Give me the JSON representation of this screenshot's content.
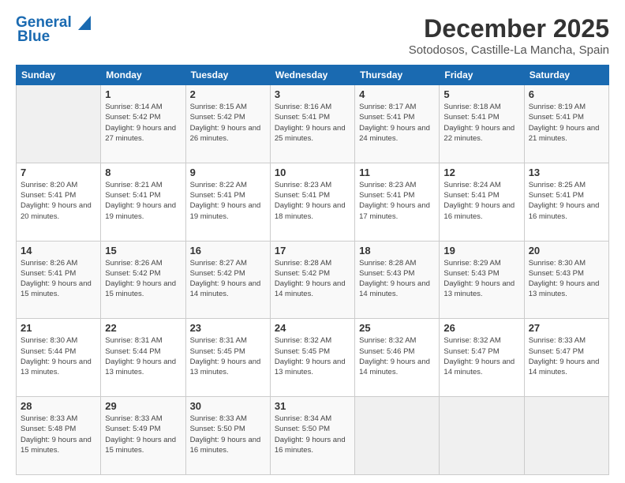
{
  "logo": {
    "text1": "General",
    "text2": "Blue"
  },
  "header": {
    "title": "December 2025",
    "subtitle": "Sotodosos, Castille-La Mancha, Spain"
  },
  "weekdays": [
    "Sunday",
    "Monday",
    "Tuesday",
    "Wednesday",
    "Thursday",
    "Friday",
    "Saturday"
  ],
  "weeks": [
    [
      {
        "day": "",
        "sunrise": "",
        "sunset": "",
        "daylight": ""
      },
      {
        "day": "1",
        "sunrise": "Sunrise: 8:14 AM",
        "sunset": "Sunset: 5:42 PM",
        "daylight": "Daylight: 9 hours and 27 minutes."
      },
      {
        "day": "2",
        "sunrise": "Sunrise: 8:15 AM",
        "sunset": "Sunset: 5:42 PM",
        "daylight": "Daylight: 9 hours and 26 minutes."
      },
      {
        "day": "3",
        "sunrise": "Sunrise: 8:16 AM",
        "sunset": "Sunset: 5:41 PM",
        "daylight": "Daylight: 9 hours and 25 minutes."
      },
      {
        "day": "4",
        "sunrise": "Sunrise: 8:17 AM",
        "sunset": "Sunset: 5:41 PM",
        "daylight": "Daylight: 9 hours and 24 minutes."
      },
      {
        "day": "5",
        "sunrise": "Sunrise: 8:18 AM",
        "sunset": "Sunset: 5:41 PM",
        "daylight": "Daylight: 9 hours and 22 minutes."
      },
      {
        "day": "6",
        "sunrise": "Sunrise: 8:19 AM",
        "sunset": "Sunset: 5:41 PM",
        "daylight": "Daylight: 9 hours and 21 minutes."
      }
    ],
    [
      {
        "day": "7",
        "sunrise": "Sunrise: 8:20 AM",
        "sunset": "Sunset: 5:41 PM",
        "daylight": "Daylight: 9 hours and 20 minutes."
      },
      {
        "day": "8",
        "sunrise": "Sunrise: 8:21 AM",
        "sunset": "Sunset: 5:41 PM",
        "daylight": "Daylight: 9 hours and 19 minutes."
      },
      {
        "day": "9",
        "sunrise": "Sunrise: 8:22 AM",
        "sunset": "Sunset: 5:41 PM",
        "daylight": "Daylight: 9 hours and 19 minutes."
      },
      {
        "day": "10",
        "sunrise": "Sunrise: 8:23 AM",
        "sunset": "Sunset: 5:41 PM",
        "daylight": "Daylight: 9 hours and 18 minutes."
      },
      {
        "day": "11",
        "sunrise": "Sunrise: 8:23 AM",
        "sunset": "Sunset: 5:41 PM",
        "daylight": "Daylight: 9 hours and 17 minutes."
      },
      {
        "day": "12",
        "sunrise": "Sunrise: 8:24 AM",
        "sunset": "Sunset: 5:41 PM",
        "daylight": "Daylight: 9 hours and 16 minutes."
      },
      {
        "day": "13",
        "sunrise": "Sunrise: 8:25 AM",
        "sunset": "Sunset: 5:41 PM",
        "daylight": "Daylight: 9 hours and 16 minutes."
      }
    ],
    [
      {
        "day": "14",
        "sunrise": "Sunrise: 8:26 AM",
        "sunset": "Sunset: 5:41 PM",
        "daylight": "Daylight: 9 hours and 15 minutes."
      },
      {
        "day": "15",
        "sunrise": "Sunrise: 8:26 AM",
        "sunset": "Sunset: 5:42 PM",
        "daylight": "Daylight: 9 hours and 15 minutes."
      },
      {
        "day": "16",
        "sunrise": "Sunrise: 8:27 AM",
        "sunset": "Sunset: 5:42 PM",
        "daylight": "Daylight: 9 hours and 14 minutes."
      },
      {
        "day": "17",
        "sunrise": "Sunrise: 8:28 AM",
        "sunset": "Sunset: 5:42 PM",
        "daylight": "Daylight: 9 hours and 14 minutes."
      },
      {
        "day": "18",
        "sunrise": "Sunrise: 8:28 AM",
        "sunset": "Sunset: 5:43 PM",
        "daylight": "Daylight: 9 hours and 14 minutes."
      },
      {
        "day": "19",
        "sunrise": "Sunrise: 8:29 AM",
        "sunset": "Sunset: 5:43 PM",
        "daylight": "Daylight: 9 hours and 13 minutes."
      },
      {
        "day": "20",
        "sunrise": "Sunrise: 8:30 AM",
        "sunset": "Sunset: 5:43 PM",
        "daylight": "Daylight: 9 hours and 13 minutes."
      }
    ],
    [
      {
        "day": "21",
        "sunrise": "Sunrise: 8:30 AM",
        "sunset": "Sunset: 5:44 PM",
        "daylight": "Daylight: 9 hours and 13 minutes."
      },
      {
        "day": "22",
        "sunrise": "Sunrise: 8:31 AM",
        "sunset": "Sunset: 5:44 PM",
        "daylight": "Daylight: 9 hours and 13 minutes."
      },
      {
        "day": "23",
        "sunrise": "Sunrise: 8:31 AM",
        "sunset": "Sunset: 5:45 PM",
        "daylight": "Daylight: 9 hours and 13 minutes."
      },
      {
        "day": "24",
        "sunrise": "Sunrise: 8:32 AM",
        "sunset": "Sunset: 5:45 PM",
        "daylight": "Daylight: 9 hours and 13 minutes."
      },
      {
        "day": "25",
        "sunrise": "Sunrise: 8:32 AM",
        "sunset": "Sunset: 5:46 PM",
        "daylight": "Daylight: 9 hours and 14 minutes."
      },
      {
        "day": "26",
        "sunrise": "Sunrise: 8:32 AM",
        "sunset": "Sunset: 5:47 PM",
        "daylight": "Daylight: 9 hours and 14 minutes."
      },
      {
        "day": "27",
        "sunrise": "Sunrise: 8:33 AM",
        "sunset": "Sunset: 5:47 PM",
        "daylight": "Daylight: 9 hours and 14 minutes."
      }
    ],
    [
      {
        "day": "28",
        "sunrise": "Sunrise: 8:33 AM",
        "sunset": "Sunset: 5:48 PM",
        "daylight": "Daylight: 9 hours and 15 minutes."
      },
      {
        "day": "29",
        "sunrise": "Sunrise: 8:33 AM",
        "sunset": "Sunset: 5:49 PM",
        "daylight": "Daylight: 9 hours and 15 minutes."
      },
      {
        "day": "30",
        "sunrise": "Sunrise: 8:33 AM",
        "sunset": "Sunset: 5:50 PM",
        "daylight": "Daylight: 9 hours and 16 minutes."
      },
      {
        "day": "31",
        "sunrise": "Sunrise: 8:34 AM",
        "sunset": "Sunset: 5:50 PM",
        "daylight": "Daylight: 9 hours and 16 minutes."
      },
      {
        "day": "",
        "sunrise": "",
        "sunset": "",
        "daylight": ""
      },
      {
        "day": "",
        "sunrise": "",
        "sunset": "",
        "daylight": ""
      },
      {
        "day": "",
        "sunrise": "",
        "sunset": "",
        "daylight": ""
      }
    ]
  ]
}
